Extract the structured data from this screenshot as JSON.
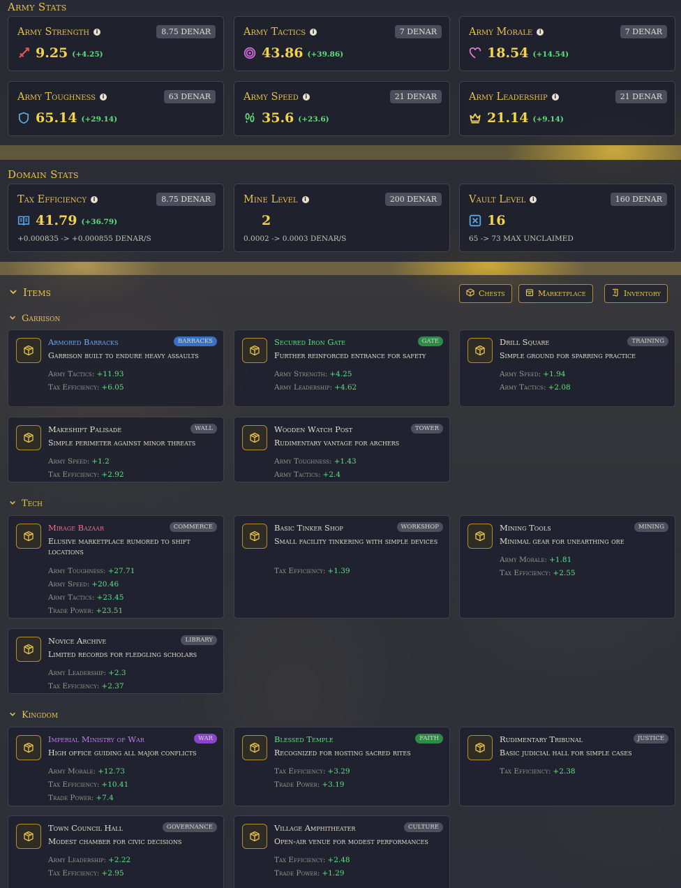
{
  "army_stats": {
    "title": "Army Stats",
    "cards": [
      {
        "label": "Army Strength",
        "price": "8.75 DENAR",
        "value": "9.25",
        "delta": "(+4.25)",
        "icon": "sword-icon",
        "color": "#e05a5a"
      },
      {
        "label": "Army Tactics",
        "price": "7 DENAR",
        "value": "43.86",
        "delta": "(+39.86)",
        "icon": "target-icon",
        "color": "#d06ad8"
      },
      {
        "label": "Army Morale",
        "price": "7 DENAR",
        "value": "18.54",
        "delta": "(+14.54)",
        "icon": "heart-icon",
        "color": "#e17ad0"
      },
      {
        "label": "Army Toughness",
        "price": "63 DENAR",
        "value": "65.14",
        "delta": "(+29.14)",
        "icon": "shield-icon",
        "color": "#5aa8e6"
      },
      {
        "label": "Army Speed",
        "price": "21 DENAR",
        "value": "35.6",
        "delta": "(+23.6)",
        "icon": "footprints-icon",
        "color": "#5fe07d"
      },
      {
        "label": "Army Leadership",
        "price": "21 DENAR",
        "value": "21.14",
        "delta": "(+9.14)",
        "icon": "crown-icon",
        "color": "#f1d44b"
      }
    ]
  },
  "domain_stats": {
    "title": "Domain Stats",
    "cards": [
      {
        "label": "Tax Efficiency",
        "price": "8.75 DENAR",
        "value": "41.79",
        "delta": "(+36.79)",
        "sub": "+0.000835 -> +0.000855 DENAR/S",
        "icon": "book-icon",
        "color": "#5aa8e6"
      },
      {
        "label": "Mine Level",
        "price": "200 DENAR",
        "value": "2",
        "delta": "",
        "sub": "0.0002 -> 0.0003 DENAR/S",
        "icon": "pickaxe-icon",
        "color": "#5aa8e6"
      },
      {
        "label": "Vault Level",
        "price": "160 DENAR",
        "value": "16",
        "delta": "",
        "sub": "65 -> 73 MAX UNCLAIMED",
        "icon": "vault-icon",
        "color": "#5aa8e6"
      }
    ]
  },
  "items": {
    "title": "Items",
    "buttons": {
      "chests": "Chests",
      "marketplace": "Marketplace",
      "inventory": "Inventory"
    },
    "groups": [
      {
        "title": "Garrison",
        "items": [
          {
            "name": "Armored Barracks",
            "tag": "BARRACKS",
            "desc": "Garrison built to endure heavy assaults",
            "stats": [
              [
                "Army Tactics:",
                "+11.93"
              ],
              [
                "Tax Efficiency:",
                "+6.05"
              ]
            ],
            "name_color": "#6fa8f0",
            "tag_color": "#3b6fc4"
          },
          {
            "name": "Secured Iron Gate",
            "tag": "GATE",
            "desc": "Further reinforced entrance for safety",
            "stats": [
              [
                "Army Strength:",
                "+4.25"
              ],
              [
                "Army Leadership:",
                "+4.62"
              ]
            ],
            "name_color": "#5fe07d",
            "tag_color": "#2e8a47"
          },
          {
            "name": "Drill Square",
            "tag": "TRAINING",
            "desc": "Simple ground for sparring practice",
            "stats": [
              [
                "Army Speed:",
                "+1.94"
              ],
              [
                "Army Tactics:",
                "+2.08"
              ]
            ],
            "name_color": "#e3ddca",
            "tag_color": "#4d4f5e"
          },
          {
            "name": "Makeshift Palisade",
            "tag": "WALL",
            "desc": "Simple perimeter against minor threats",
            "stats": [
              [
                "Army Speed:",
                "+1.2"
              ],
              [
                "Tax Efficiency:",
                "+2.92"
              ]
            ],
            "name_color": "#e3ddca",
            "tag_color": "#4d4f5e"
          },
          {
            "name": "Wooden Watch Post",
            "tag": "TOWER",
            "desc": "Rudimentary vantage for archers",
            "stats": [
              [
                "Army Toughness:",
                "+1.43"
              ],
              [
                "Army Tactics:",
                "+2.4"
              ]
            ],
            "name_color": "#e3ddca",
            "tag_color": "#4d4f5e"
          }
        ]
      },
      {
        "title": "Tech",
        "items": [
          {
            "name": "Mirage Bazaar",
            "tag": "COMMERCE",
            "desc": "Elusive marketplace rumored to shift locations",
            "stats": [
              [
                "Army Toughness:",
                "+27.71"
              ],
              [
                "Army Speed:",
                "+20.46"
              ],
              [
                "Army Tactics:",
                "+23.45"
              ],
              [
                "Trade Power:",
                "+23.51"
              ]
            ],
            "name_color": "#f0708a",
            "tag_color": "#4d4f5e"
          },
          {
            "name": "Basic Tinker Shop",
            "tag": "WORKSHOP",
            "desc": "Small facility tinkering with simple devices",
            "stats": [
              [
                "Tax Efficiency:",
                "+1.39"
              ]
            ],
            "name_color": "#e3ddca",
            "tag_color": "#4d4f5e"
          },
          {
            "name": "Mining Tools",
            "tag": "MINING",
            "desc": "Minimal gear for unearthing ore",
            "stats": [
              [
                "Army Morale:",
                "+1.81"
              ],
              [
                "Tax Efficiency:",
                "+2.55"
              ]
            ],
            "name_color": "#e3ddca",
            "tag_color": "#4d4f5e"
          },
          {
            "name": "Novice Archive",
            "tag": "LIBRARY",
            "desc": "Limited records for fledgling scholars",
            "stats": [
              [
                "Army Leadership:",
                "+2.3"
              ],
              [
                "Tax Efficiency:",
                "+2.37"
              ]
            ],
            "name_color": "#e3ddca",
            "tag_color": "#4d4f5e"
          }
        ]
      },
      {
        "title": "Kingdom",
        "items": [
          {
            "name": "Imperial Ministry of War",
            "tag": "WAR",
            "desc": "High office guiding all major conflicts",
            "stats": [
              [
                "Army Morale:",
                "+12.73"
              ],
              [
                "Tax Efficiency:",
                "+10.41"
              ],
              [
                "Trade Power:",
                "+7.4"
              ]
            ],
            "name_color": "#c07cf0",
            "tag_color": "#8a45c8"
          },
          {
            "name": "Blessed Temple",
            "tag": "FAITH",
            "desc": "Recognized for hosting sacred rites",
            "stats": [
              [
                "Tax Efficiency:",
                "+3.29"
              ],
              [
                "Trade Power:",
                "+3.19"
              ]
            ],
            "name_color": "#5fe07d",
            "tag_color": "#2e8a47"
          },
          {
            "name": "Rudimentary Tribunal",
            "tag": "JUSTICE",
            "desc": "Basic judicial hall for simple cases",
            "stats": [
              [
                "Tax Efficiency:",
                "+2.38"
              ]
            ],
            "name_color": "#e3ddca",
            "tag_color": "#4d4f5e"
          },
          {
            "name": "Town Council Hall",
            "tag": "GOVERNANCE",
            "desc": "Modest chamber for civic decisions",
            "stats": [
              [
                "Army Leadership:",
                "+2.22"
              ],
              [
                "Tax Efficiency:",
                "+2.95"
              ]
            ],
            "name_color": "#e3ddca",
            "tag_color": "#4d4f5e"
          },
          {
            "name": "Village Amphitheater",
            "tag": "CULTURE",
            "desc": "Open-air venue for modest performances",
            "stats": [
              [
                "Tax Efficiency:",
                "+2.48"
              ],
              [
                "Trade Power:",
                "+1.29"
              ]
            ],
            "name_color": "#e3ddca",
            "tag_color": "#4d4f5e"
          }
        ]
      }
    ]
  }
}
